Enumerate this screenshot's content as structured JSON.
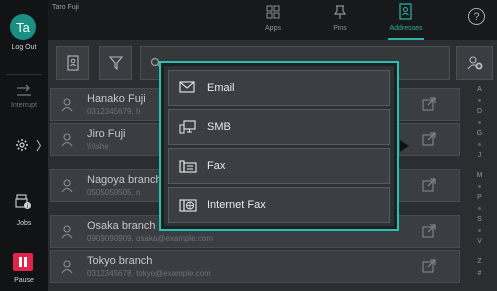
{
  "user": {
    "initials": "Ta",
    "name": "Taro Fuji"
  },
  "left_rail": {
    "logout_label": "Log Out",
    "interrupt_label": "Interrupt",
    "jobs_label": "Jobs",
    "pause_label": "Pause",
    "settings_chevron": "〉"
  },
  "top_tabs": [
    {
      "label": "Apps",
      "icon": "apps-grid-icon"
    },
    {
      "label": "Pins",
      "icon": "pin-icon"
    },
    {
      "label": "Addresses",
      "icon": "address-book-icon",
      "active": true
    }
  ],
  "help_label": "?",
  "contacts": [
    {
      "name": "Hanako Fuji",
      "detail": "0312345679, h"
    },
    {
      "name": "Jiro Fuji",
      "detail": "\\\\\\\\she"
    },
    {
      "name": "Nagoya branch",
      "detail": "0505050505, n"
    },
    {
      "name": "Osaka branch",
      "detail": "0909090909, osaka@example.com"
    },
    {
      "name": "Tokyo branch",
      "detail": "0312345678, tokyo@example.com"
    }
  ],
  "alphabet_index": [
    "A",
    "D",
    "G",
    "J",
    "M",
    "P",
    "S",
    "V",
    "Z",
    "#"
  ],
  "popup_menu": [
    {
      "label": "Email",
      "icon": "envelope-icon"
    },
    {
      "label": "SMB",
      "icon": "computer-network-icon"
    },
    {
      "label": "Fax",
      "icon": "fax-icon"
    },
    {
      "label": "Internet Fax",
      "icon": "internet-fax-icon"
    }
  ],
  "colors": {
    "accent": "#23c2b1",
    "pause": "#e0254a",
    "avatar": "#1a8f84"
  }
}
